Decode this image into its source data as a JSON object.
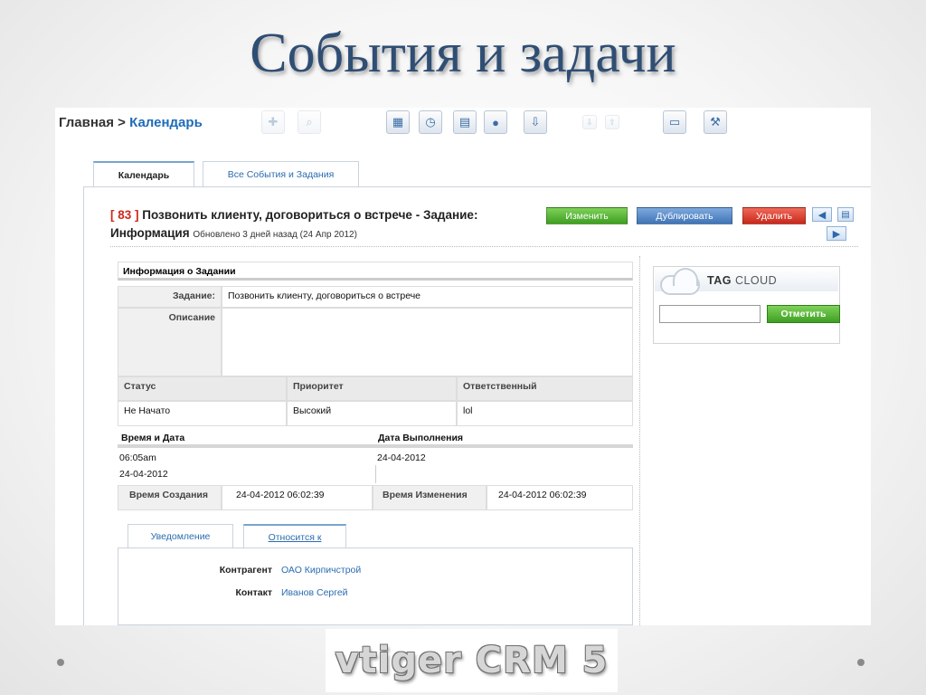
{
  "slide": {
    "title": "События и задачи",
    "logo_text": "vtiger CRM 5"
  },
  "breadcrumb": {
    "home": "Главная",
    "sep": " > ",
    "current": "Календарь"
  },
  "toolbar": {
    "icons": [
      "add-icon",
      "search-icon",
      "calendar-icon",
      "clock-icon",
      "calculator-icon",
      "chat-icon",
      "import-icon",
      "export-icon",
      "upload-icon",
      "computer-icon",
      "settings-icon"
    ]
  },
  "tabs": {
    "calendar": "Календарь",
    "all": "Все События и Задания"
  },
  "record": {
    "number": "[ 83 ]",
    "title": " Позвонить клиенту, договориться о встрече - Задание:",
    "subtitle": "Информация",
    "updated": "Обновлено 3 дней назад (24 Апр 2012)"
  },
  "buttons": {
    "edit": "Изменить",
    "duplicate": "Дублировать",
    "delete": "Удалить"
  },
  "info": {
    "header": "Информация о Задании",
    "task_label": "Задание:",
    "task_value": "Позвонить клиенту, договориться о встрече",
    "desc_label": "Описание",
    "status_label": "Статус",
    "priority_label": "Приоритет",
    "owner_label": "Ответственный",
    "status_value": "Не Начато",
    "priority_value": "Высокий",
    "owner_value": "lol",
    "datetime_label": "Время и Дата",
    "due_label": "Дата Выполнения",
    "time_value": "06:05am",
    "date_value": "24-04-2012",
    "due_value": "24-04-2012",
    "created_label": "Время Создания",
    "created_value": "24-04-2012 06:02:39",
    "modified_label": "Время Изменения",
    "modified_value": "24-04-2012 06:02:39"
  },
  "subtabs": {
    "notification": "Уведомление",
    "related": "Относится к"
  },
  "related": {
    "account_label": "Контрагент",
    "account_value": "ОАО Кирпичстрой",
    "contact_label": "Контакт",
    "contact_value": "Иванов Сергей"
  },
  "tagcloud": {
    "title_a": "TAG",
    "title_b": " CLOUD",
    "button": "Отметить",
    "input": ""
  }
}
